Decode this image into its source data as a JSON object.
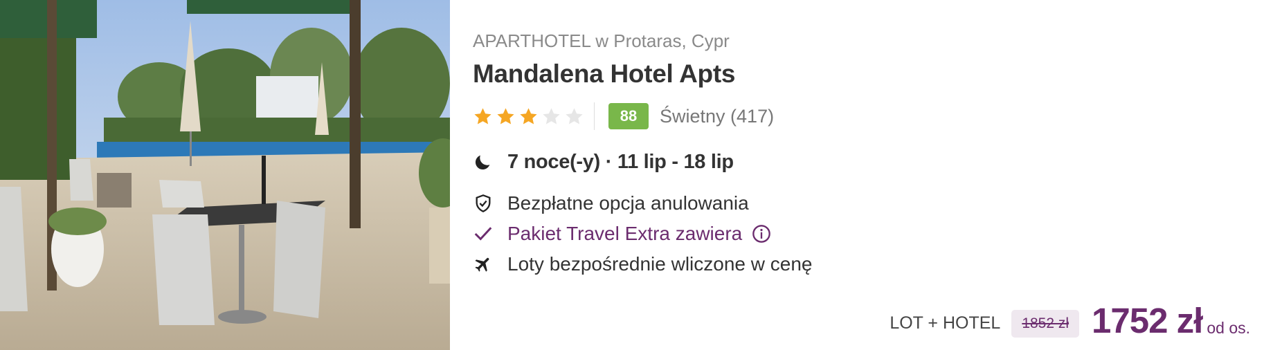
{
  "hotel": {
    "category_location": "APARTHOTEL w Protaras, Cypr",
    "name": "Mandalena Hotel Apts",
    "stars": 3,
    "max_stars": 5,
    "score": "88",
    "score_text": "Świetny (417)",
    "photo_icon": "hotel-terrace-photo"
  },
  "stay": {
    "dates": "7 noce(-y) · 11 lip - 18 lip",
    "icon": "moon-icon"
  },
  "features": [
    {
      "text": "Bezpłatne opcja anulowania",
      "icon": "shield-check-icon"
    },
    {
      "text": "Pakiet Travel Extra zawiera",
      "icon": "checkmark-icon"
    },
    {
      "text": "Loty bezpośrednie wliczone w cenę",
      "icon": "airplane-icon"
    }
  ],
  "price": {
    "package_label": "LOT + HOTEL",
    "old_price": "1852 zł",
    "new_price": "1752 zł",
    "per_person": "od os."
  },
  "colors": {
    "accent": "#6b2c6e",
    "score_bg": "#79b74a",
    "star_on": "#f5a623",
    "star_off": "#e6e6e6"
  }
}
